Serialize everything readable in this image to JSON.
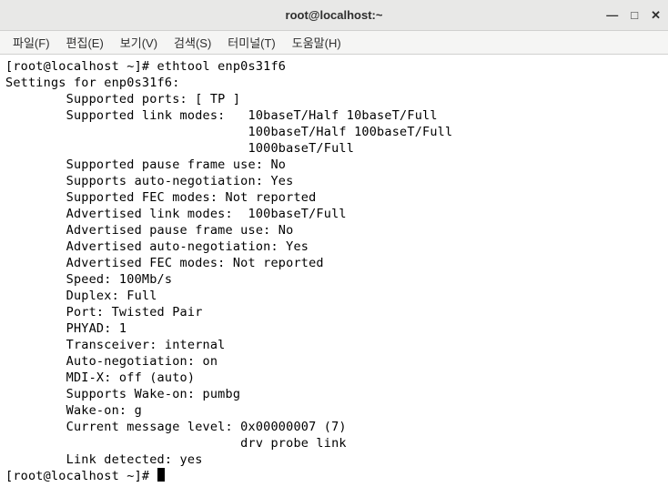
{
  "window": {
    "title": "root@localhost:~",
    "controls": {
      "minimize": "—",
      "maximize": "□",
      "close": "✕"
    }
  },
  "menubar": {
    "file": "파일(F)",
    "edit": "편집(E)",
    "view": "보기(V)",
    "search": "검색(S)",
    "terminal": "터미널(T)",
    "help": "도움말(H)"
  },
  "terminal": {
    "line01": "[root@localhost ~]# ethtool enp0s31f6",
    "line02": "Settings for enp0s31f6:",
    "line03": "        Supported ports: [ TP ]",
    "line04": "        Supported link modes:   10baseT/Half 10baseT/Full",
    "line05": "                                100baseT/Half 100baseT/Full",
    "line06": "                                1000baseT/Full",
    "line07": "        Supported pause frame use: No",
    "line08": "        Supports auto-negotiation: Yes",
    "line09": "        Supported FEC modes: Not reported",
    "line10": "        Advertised link modes:  100baseT/Full",
    "line11": "        Advertised pause frame use: No",
    "line12": "        Advertised auto-negotiation: Yes",
    "line13": "        Advertised FEC modes: Not reported",
    "line14": "        Speed: 100Mb/s",
    "line15": "        Duplex: Full",
    "line16": "        Port: Twisted Pair",
    "line17": "        PHYAD: 1",
    "line18": "        Transceiver: internal",
    "line19": "        Auto-negotiation: on",
    "line20": "        MDI-X: off (auto)",
    "line21": "        Supports Wake-on: pumbg",
    "line22": "        Wake-on: g",
    "line23": "        Current message level: 0x00000007 (7)",
    "line24": "                               drv probe link",
    "line25": "        Link detected: yes",
    "line26": "[root@localhost ~]# "
  }
}
